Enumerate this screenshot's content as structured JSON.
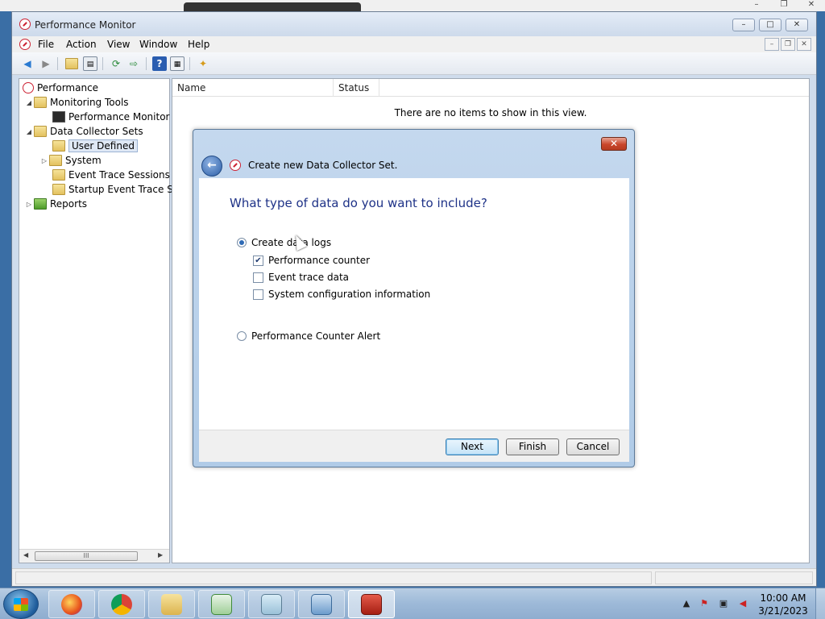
{
  "window": {
    "title": "Performance Monitor",
    "controls": {
      "minimize": "–",
      "maximize": "□",
      "close": "✕"
    },
    "mdi_controls": {
      "minimize": "–",
      "restore": "❐",
      "close": "✕"
    }
  },
  "menu": {
    "file": "File",
    "action": "Action",
    "view": "View",
    "window": "Window",
    "help": "Help"
  },
  "tree": {
    "root": "Performance",
    "monitoring_tools": "Monitoring Tools",
    "performance_monitor": "Performance Monitor",
    "data_collector_sets": "Data Collector Sets",
    "user_defined": "User Defined",
    "system": "System",
    "event_trace_sessions": "Event Trace Sessions",
    "startup_event_trace": "Startup Event Trace Ses",
    "reports": "Reports",
    "scroll_thumb": "III"
  },
  "list": {
    "columns": [
      "Name",
      "Status"
    ],
    "empty_message": "There are no items to show in this view."
  },
  "dialog": {
    "close_label": "✕",
    "back_glyph": "←",
    "title": "Create new Data Collector Set.",
    "heading": "What type of data do you want to include?",
    "options": {
      "create_logs": {
        "label": "Create data logs",
        "selected": true
      },
      "performance_counter": {
        "label": "Performance counter",
        "checked": true
      },
      "event_trace": {
        "label": "Event trace data",
        "checked": false
      },
      "system_config": {
        "label": "System configuration information",
        "checked": false
      },
      "alert": {
        "label": "Performance Counter Alert",
        "selected": false
      }
    },
    "buttons": {
      "next": "Next",
      "finish": "Finish",
      "cancel": "Cancel"
    }
  },
  "taskbar": {
    "clock_time": "10:00 AM",
    "clock_date": "3/21/2023",
    "apps": [
      "firefox",
      "chrome",
      "file-explorer",
      "excel",
      "notepad",
      "control-panel",
      "toolbox"
    ]
  },
  "colors": {
    "accent": "#2f6bb5",
    "heading": "#1e3287",
    "close": "#c9452b"
  }
}
